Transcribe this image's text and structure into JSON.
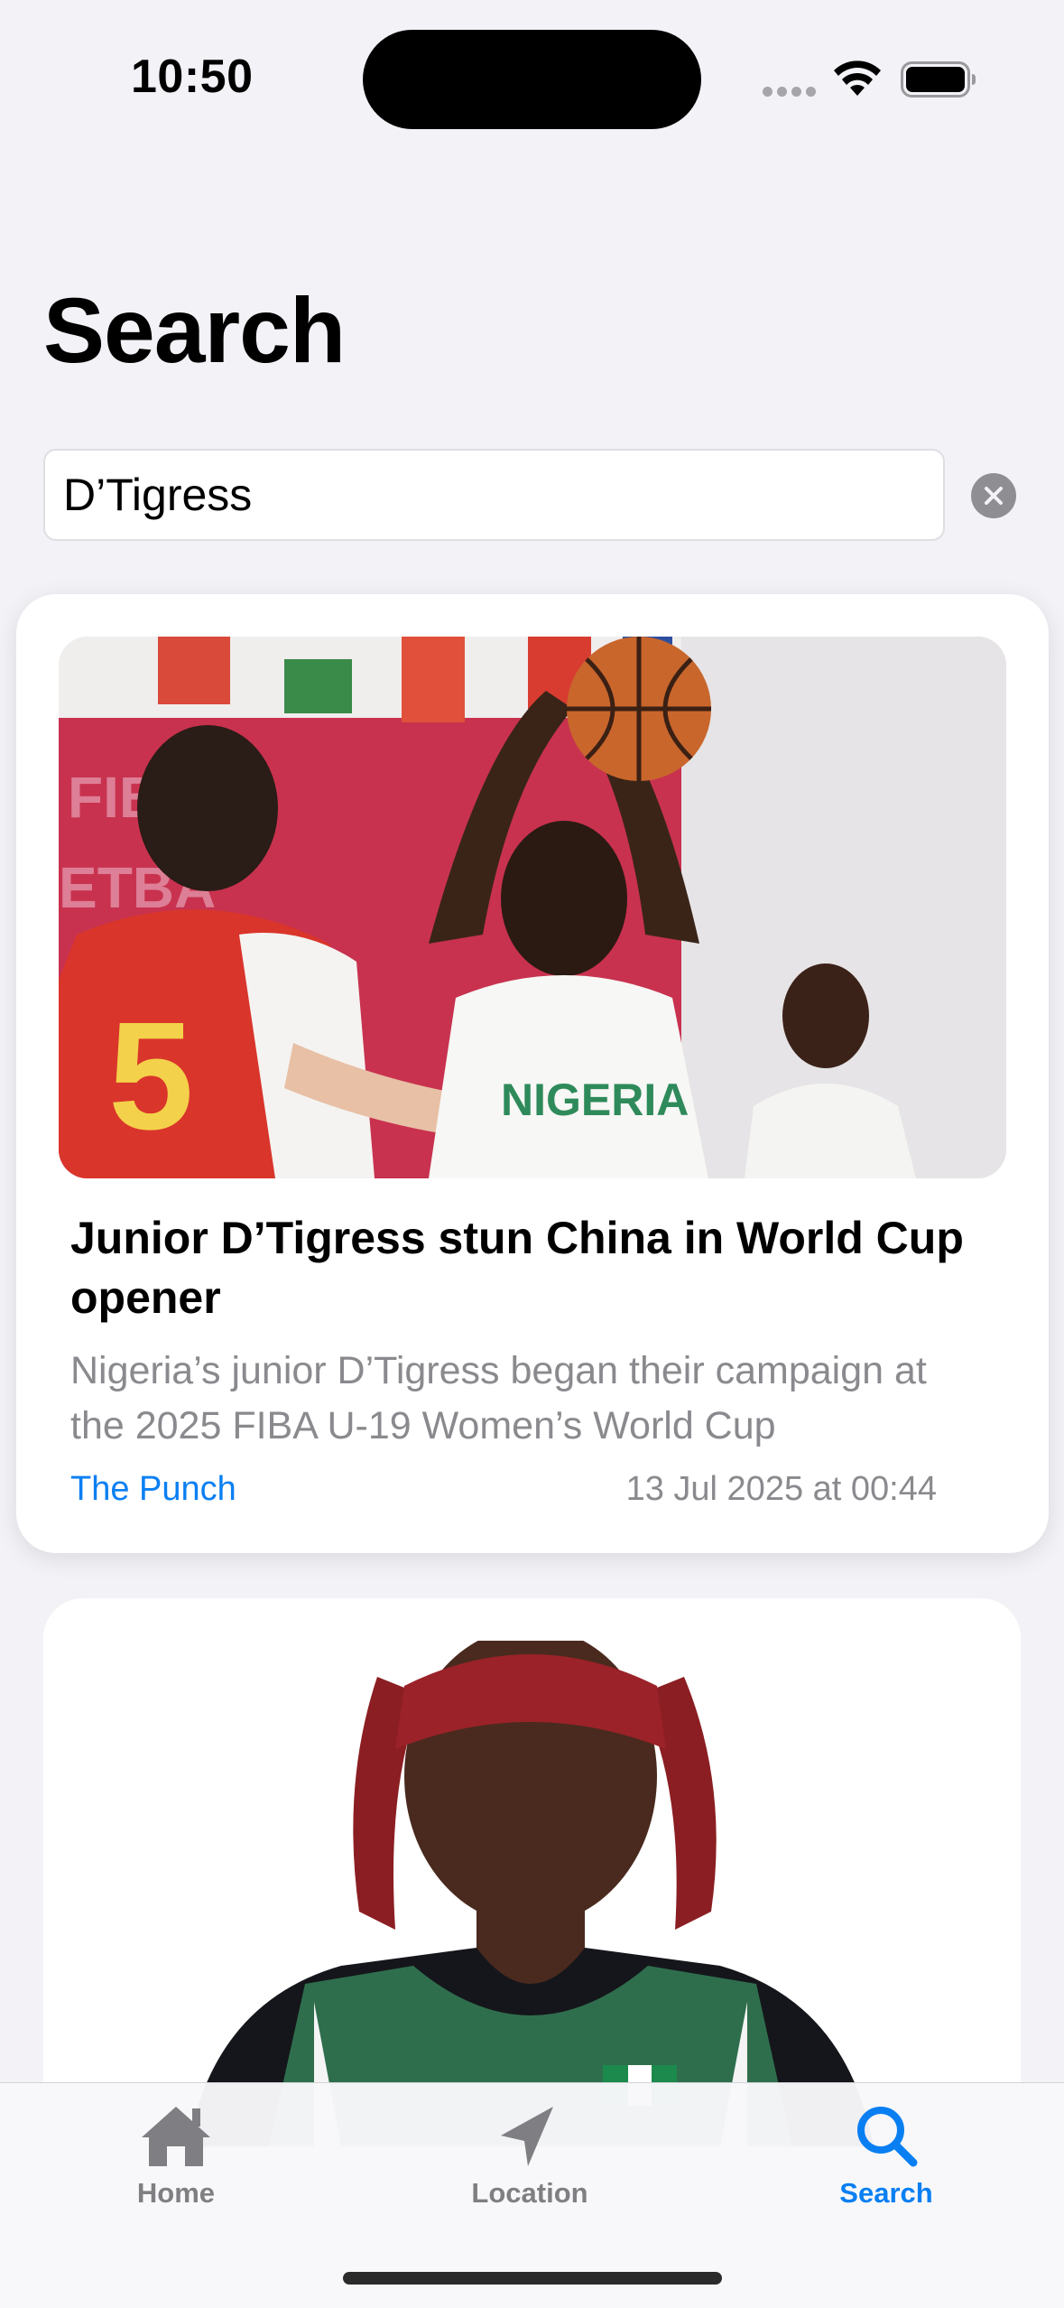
{
  "status_bar": {
    "time": "10:50"
  },
  "page": {
    "title": "Search"
  },
  "search": {
    "value": "D’Tigress"
  },
  "results": [
    {
      "title": "Junior D’Tigress stun China in World Cup opener",
      "summary": "Nigeria’s junior D’Tigress began their campaign at the 2025 FIBA U-19 Women’s World Cup",
      "source": "The Punch",
      "date": "13 Jul 2025 at 00:44"
    }
  ],
  "tab_bar": {
    "items": [
      {
        "label": "Home",
        "icon": "house-icon",
        "active": false
      },
      {
        "label": "Location",
        "icon": "location-arrow-icon",
        "active": false
      },
      {
        "label": "Search",
        "icon": "magnifying-glass-icon",
        "active": true
      }
    ]
  },
  "colors": {
    "accent": "#0a7ff2",
    "background": "#f2f2f7",
    "inactive_tab": "#7f7f83",
    "secondary_text": "#8a8a8e"
  }
}
